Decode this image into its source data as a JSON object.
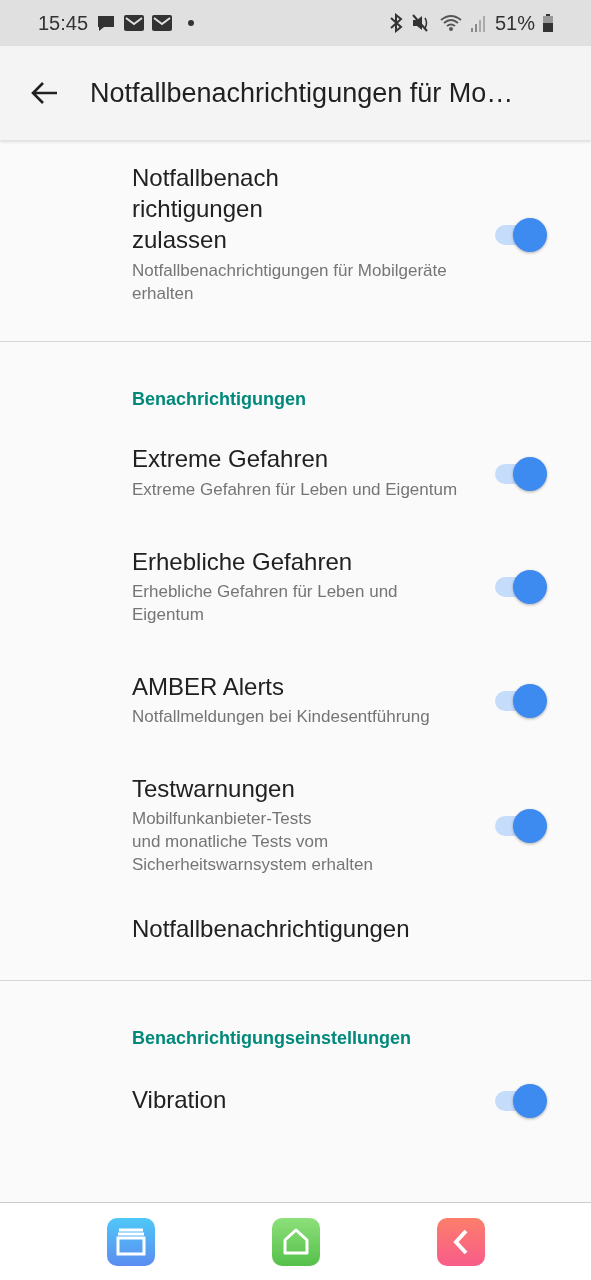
{
  "status_bar": {
    "time": "15:45",
    "battery": "51%"
  },
  "app_bar": {
    "title": "Notfallbenachrichtigungen für Mo…"
  },
  "sections": [
    {
      "items": [
        {
          "kind": "switch",
          "title": "Notfallbenach\nrichtigungen\nzulassen",
          "subtitle": "Notfallbenachrichtigungen für Mobilgeräte erhalten",
          "on": true
        }
      ]
    },
    {
      "header": "Benachrichtigungen",
      "items": [
        {
          "kind": "switch",
          "title": "Extreme Gefahren",
          "subtitle": "Extreme Gefahren für Leben und Eigentum",
          "on": true
        },
        {
          "kind": "switch",
          "title": "Erhebliche Gefahren",
          "subtitle": "Erhebliche Gefahren für Leben und Eigentum",
          "on": true
        },
        {
          "kind": "switch",
          "title": "AMBER Alerts",
          "subtitle": "Notfallmeldungen bei Kindesentführung",
          "on": true
        },
        {
          "kind": "switch",
          "title": "Testwarnungen",
          "subtitle": "Mobilfunkanbieter-Tests\nund monatliche Tests vom Sicherheitswarnsystem erhalten",
          "on": true
        },
        {
          "kind": "link",
          "title": "Notfallbenachrichtigungen"
        }
      ]
    },
    {
      "header": "Benachrichtigungseinstellungen",
      "items": [
        {
          "kind": "switch",
          "title": "Vibration",
          "on": true
        }
      ]
    }
  ]
}
